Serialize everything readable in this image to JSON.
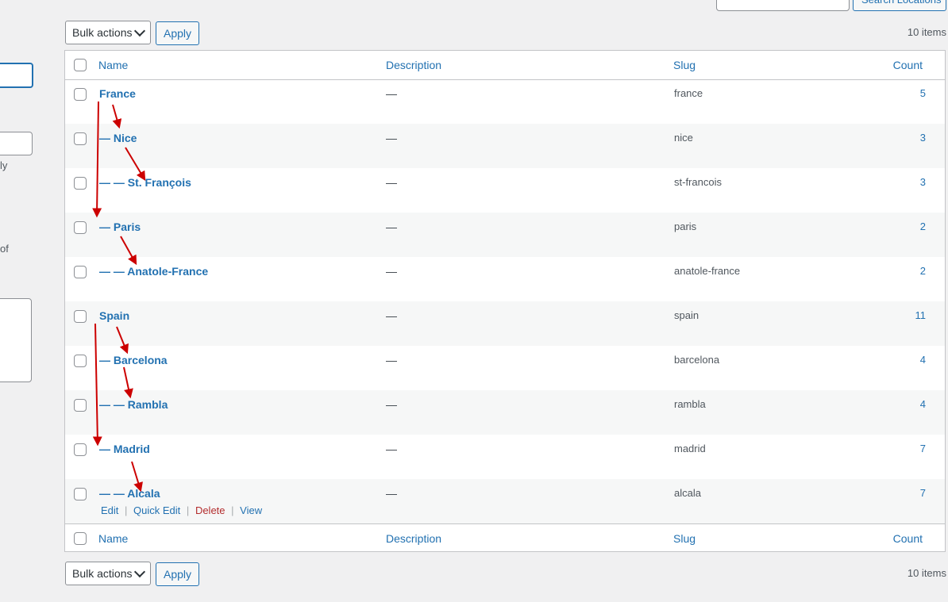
{
  "left_form": {
    "text_ly": "ly",
    "text_of": "of"
  },
  "search": {
    "button_label": "Search Locations"
  },
  "tablenav_top": {
    "bulk_label": "Bulk actions",
    "apply_label": "Apply",
    "items_count": "10 items"
  },
  "tablenav_bottom": {
    "bulk_label": "Bulk actions",
    "apply_label": "Apply",
    "items_count": "10 items"
  },
  "table": {
    "columns": {
      "name": "Name",
      "description": "Description",
      "slug": "Slug",
      "count": "Count"
    },
    "rows": [
      {
        "name": "France",
        "description": "—",
        "slug": "france",
        "count": "5"
      },
      {
        "name": "— Nice",
        "description": "—",
        "slug": "nice",
        "count": "3"
      },
      {
        "name": "— — St. François",
        "description": "—",
        "slug": "st-francois",
        "count": "3"
      },
      {
        "name": "— Paris",
        "description": "—",
        "slug": "paris",
        "count": "2"
      },
      {
        "name": "— — Anatole-France",
        "description": "—",
        "slug": "anatole-france",
        "count": "2"
      },
      {
        "name": "Spain",
        "description": "—",
        "slug": "spain",
        "count": "11"
      },
      {
        "name": "— Barcelona",
        "description": "—",
        "slug": "barcelona",
        "count": "4"
      },
      {
        "name": "— — Rambla",
        "description": "—",
        "slug": "rambla",
        "count": "4"
      },
      {
        "name": "— Madrid",
        "description": "—",
        "slug": "madrid",
        "count": "7"
      },
      {
        "name": "— — Alcala",
        "description": "—",
        "slug": "alcala",
        "count": "7"
      }
    ],
    "row_actions": {
      "edit": "Edit",
      "quick_edit": "Quick Edit",
      "delete": "Delete",
      "view": "View",
      "separator": "|"
    }
  },
  "colors": {
    "link": "#2271b1",
    "delete": "#b32d2e",
    "annotation_arrow": "#cc0000"
  }
}
